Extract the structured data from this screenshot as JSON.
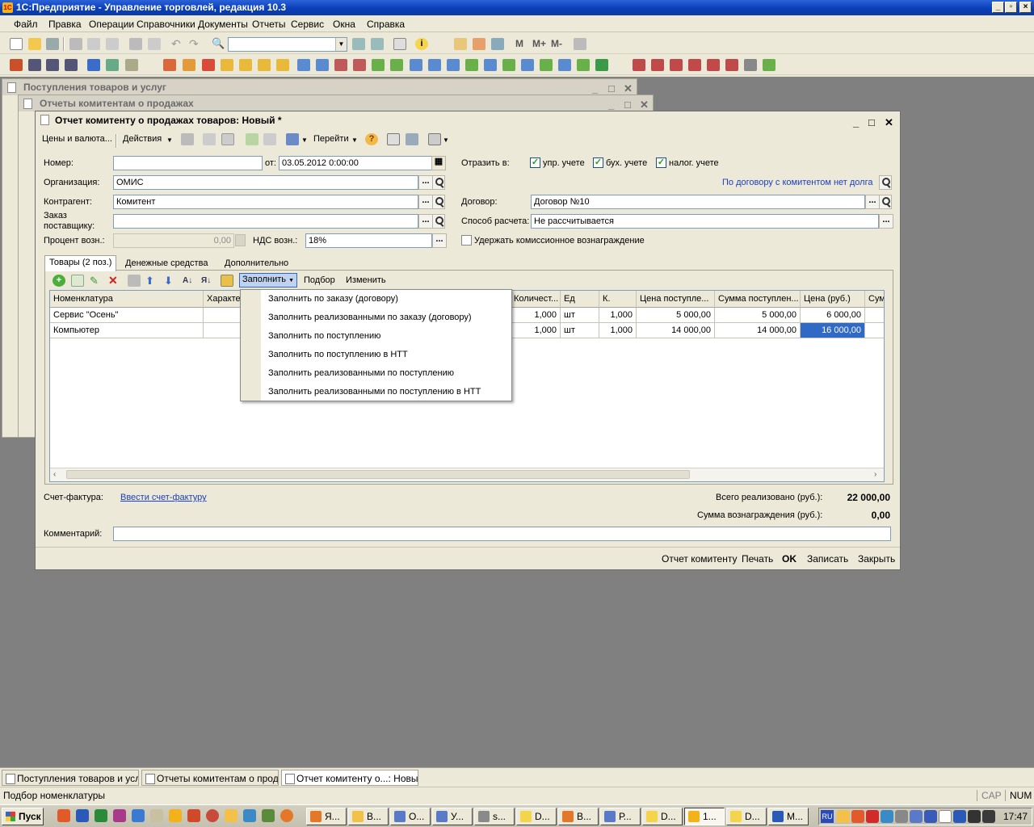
{
  "app": {
    "title": "1С:Предприятие - Управление торговлей, редакция 10.3",
    "menu": [
      "Файл",
      "Правка",
      "Операции",
      "Справочники",
      "Документы",
      "Отчеты",
      "Сервис",
      "Окна",
      "Справка"
    ],
    "memory_buttons": [
      "M",
      "M+",
      "M-"
    ]
  },
  "bg_windows": [
    {
      "title": "Поступления товаров и услуг"
    },
    {
      "title": "Отчеты комитентам о продажах"
    }
  ],
  "form": {
    "title": "Отчет комитенту о продажах товаров: Новый *",
    "toolbar": {
      "prices": "Цены и валюта...",
      "actions": "Действия",
      "goto": "Перейти"
    },
    "labels": {
      "number": "Номер:",
      "from": "от:",
      "org": "Организация:",
      "counterparty": "Контрагент:",
      "order_line1": "Заказ",
      "order_line2": "поставщику:",
      "percent": "Процент возн.:",
      "vat": "НДС возн.:",
      "reflect": "Отразить в:",
      "mgmt": "упр. учете",
      "acc": "бух. учете",
      "tax": "налог. учете",
      "contract": "Договор:",
      "payment": "Способ расчета:",
      "withhold": "Удержать комиссионное вознаграждение"
    },
    "values": {
      "number": "",
      "date": "03.05.2012  0:00:00",
      "org": "ОМИС",
      "counterparty": "Комитент",
      "order": "",
      "percent": "0,00",
      "vat": "18%",
      "contract": "Договор №10",
      "payment": "Не рассчитывается"
    },
    "checks": {
      "mgmt": true,
      "acc": true,
      "tax": true,
      "withhold": false
    },
    "debt_link": "По договору с комитентом нет долга",
    "tabs": [
      "Товары (2 поз.)",
      "Денежные средства",
      "Дополнительно"
    ],
    "table_toolbar": {
      "fill": "Заполнить",
      "pick": "Подбор",
      "change": "Изменить"
    },
    "columns": [
      "Номенклатура",
      "Характе",
      "Количест...",
      "Ед",
      "К.",
      "Цена поступле...",
      "Сумма поступлен...",
      "Цена (руб.)",
      "Сум"
    ],
    "rows": [
      {
        "name": "Сервис \"Осень\"",
        "qty": "1,000",
        "unit": "шт",
        "k": "1,000",
        "in_price": "5 000,00",
        "in_sum": "5 000,00",
        "price": "6 000,00"
      },
      {
        "name": "Компьютер",
        "qty": "1,000",
        "unit": "шт",
        "k": "1,000",
        "in_price": "14 000,00",
        "in_sum": "14 000,00",
        "price": "16 000,00"
      }
    ],
    "fill_menu": [
      "Заполнить по заказу (договору)",
      "Заполнить реализованными по заказу (договору)",
      "Заполнить по поступлению",
      "Заполнить по поступлению в НТТ",
      "Заполнить реализованными по поступлению",
      "Заполнить реализованными по поступлению в НТТ"
    ],
    "invoice_label": "Счет-фактура:",
    "invoice_link": "Ввести счет-фактуру",
    "total_label": "Всего реализовано (руб.):",
    "total_value": "22 000,00",
    "fee_label": "Сумма вознаграждения (руб.):",
    "fee_value": "0,00",
    "comment_label": "Комментарий:",
    "comment": "",
    "bottom": {
      "report": "Отчет комитенту",
      "print": "Печать",
      "ok": "OK",
      "save": "Записать",
      "close": "Закрыть"
    }
  },
  "mdi_tabs": [
    "Поступления товаров и услуг",
    "Отчеты комитентам о прод...",
    "Отчет комитенту о...: Новый *"
  ],
  "status": {
    "text": "Подбор номенклатуры",
    "cap": "CAP",
    "num": "NUM"
  },
  "taskbar": {
    "start": "Пуск",
    "tasks": [
      "Я...",
      "В...",
      "О...",
      "У...",
      "s...",
      "D...",
      "В...",
      "Р...",
      "D...",
      "1...",
      "D...",
      "М..."
    ],
    "lang": "RU",
    "clock": "17:47"
  },
  "colors": {
    "accent": "#316ac5",
    "title_bar": "#0a3fb8",
    "link": "#1a3fc0"
  }
}
